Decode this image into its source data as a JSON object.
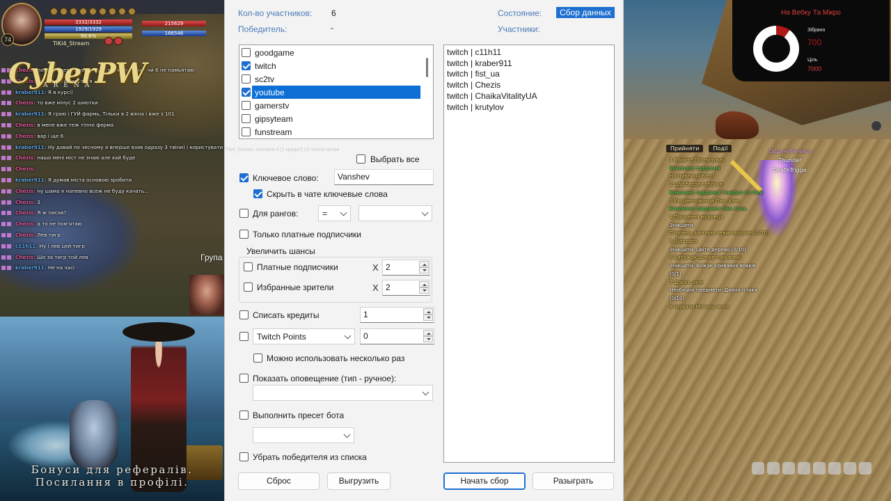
{
  "stream_left": {
    "hud": {
      "level": "74",
      "hp": "3332/3332",
      "mp": "1929/1929",
      "xp": "90.6%",
      "player_name": "TiKi4_Stream",
      "right_hp": "215629",
      "right_mp": "166546"
    },
    "chat": [
      {
        "user": "Chezis:",
        "cls": "c1",
        "text": "поножі і верх плюс мінус терпимо 5 ранг чи 6 не памьятаю"
      },
      {
        "user": "Chezis:",
        "cls": "c1",
        "text": "який порту береться"
      },
      {
        "user": "kraber911:",
        "cls": "c2",
        "text": "Я в курсі)"
      },
      {
        "user": "Chezis:",
        "cls": "c1",
        "text": "то вже мінус 2 шмотки"
      },
      {
        "user": "kraber911:",
        "cls": "c2",
        "text": "Я граю і ГУЙ фармь, Тільки в 2 вікна і вже з 101"
      },
      {
        "user": "Chezis:",
        "cls": "c1",
        "text": "в мене вже теж тіпно ферма"
      },
      {
        "user": "Chezis:",
        "cls": "c1",
        "text": "вар і ще 6"
      },
      {
        "user": "kraber911:",
        "cls": "c2",
        "text": "Ну давай по чесному я вперше взяв одразу 3 твіни) і користувати"
      },
      {
        "user": "Chezis:",
        "cls": "c1",
        "text": "нашо мені міст не знаю але хай буде"
      },
      {
        "user": "Chezis:",
        "cls": "c1",
        "text": ""
      },
      {
        "user": "kraber911:",
        "cls": "c2",
        "text": "Я думав міста основою зробити"
      },
      {
        "user": "Chezis:",
        "cls": "c1",
        "text": "ну шама я напевно всеж не буду качать..."
      },
      {
        "user": "Chezis:",
        "cls": "c1",
        "text": "3"
      },
      {
        "user": "Chezis:",
        "cls": "c1",
        "text": "Я ж писав?"
      },
      {
        "user": "Chezis:",
        "cls": "c1",
        "text": "а то не пом'ятаю"
      },
      {
        "user": "Chezis:",
        "cls": "c1",
        "text": "Лев тигр"
      },
      {
        "user": "c11h11:",
        "cls": "c2",
        "text": "Ну і лев цей тигр"
      },
      {
        "user": "Chezis:",
        "cls": "c1",
        "text": "Шо за тигр той лев"
      },
      {
        "user": "kraber911:",
        "cls": "c2",
        "text": "Не на часі"
      }
    ],
    "group_label": "Група",
    "banner": {
      "logo": "CyberPW",
      "logo_sub": "ARENA",
      "promo_line1": "Бонуси для рефералів.",
      "promo_line2": "Посилання в профілі."
    }
  },
  "app": {
    "participants_count_label": "Кол-во участников:",
    "participants_count_value": "6",
    "winner_label": "Победитель:",
    "winner_value": "-",
    "state_label": "Состояние:",
    "state_value": "Сбор данных",
    "participants_label": "Участники:",
    "platforms": [
      {
        "label": "goodgame",
        "checked": false,
        "selected": false
      },
      {
        "label": "twitch",
        "checked": true,
        "selected": false
      },
      {
        "label": "sc2tv",
        "checked": false,
        "selected": false
      },
      {
        "label": "youtube",
        "checked": true,
        "selected": true
      },
      {
        "label": "gamerstv",
        "checked": false,
        "selected": false
      },
      {
        "label": "gipsyteam",
        "checked": false,
        "selected": false
      },
      {
        "label": "funstream",
        "checked": false,
        "selected": false
      }
    ],
    "select_all_label": "Выбрать все",
    "keyword_label": "Ключевое слово:",
    "keyword_value": "Vanshev",
    "hide_keywords_label": "Скрыть в чате ключевые слова",
    "ranks_label": "Для рангов:",
    "ranks_operator": "=",
    "ranks_value": "",
    "paid_only_label": "Только платные подписчики",
    "boost_group_title": "Увеличить шансы",
    "boost_paid_label": "Платные подписчики",
    "boost_paid_mult": "2",
    "boost_fav_label": "Избранные зрители",
    "boost_fav_mult": "2",
    "x_mark": "X",
    "credits_label": "Списать кредиты",
    "credits_value": "1",
    "points_type": "Twitch Points",
    "points_value": "0",
    "multi_use_label": "Можно использовать несколько раз",
    "show_alert_label": "Показать оповещение (тип - ручное):",
    "alert_type_value": "",
    "bot_preset_label": "Выполнить пресет бота",
    "bot_preset_value": "",
    "remove_winner_label": "Убрать победителя из списка",
    "faint_text": "Tiki4_Stream: поклала 4 (1 кредит) 10 тікетів почав",
    "participants": [
      "twitch | c11h11",
      "twitch | kraber911",
      "twitch | fist_ua",
      "twitch | Chezis",
      "twitch | ChaikaVitalityUA",
      "twitch | krutylov"
    ],
    "buttons": {
      "reset": "Сброс",
      "export": "Выгрузить",
      "start": "Начать сбор",
      "draw": "Разыграть"
    }
  },
  "game_right": {
    "goal": {
      "title": "На Вебку Та Мікро",
      "collected_label": "Зібрано",
      "collected_value": "700",
      "target_label": "Ціль",
      "target_value": "7000"
    },
    "dialog_accept": "Прийняти",
    "dialog_events": "Події",
    "npc_name": "Орден Фенікса",
    "npc_sub": "Thunder",
    "npc_sub2": "DeathTrigge",
    "quests": [
      {
        "cls": "q-title",
        "text": "1 Вбийте Пронизувач"
      },
      {
        "cls": "q-done",
        "text": "Виконано завдання"
      },
      {
        "cls": "q-title",
        "text": "Наставниця Кен І"
      },
      {
        "cls": "q-title",
        "text": "2 Цар бесов-гоблінів"
      },
      {
        "cls": "q-done",
        "text": "Виконано завдання Генерал Са Фей"
      },
      {
        "cls": "q-title",
        "text": "3 Ексцентричний Лінь Хань"
      },
      {
        "cls": "q-done",
        "text": "Виконано завдання Лінь Хань"
      },
      {
        "cls": "q-title",
        "text": "4 Прохання мудреця"
      },
      {
        "cls": "q-item",
        "text": "Знищити:"
      },
      {
        "cls": "q-title",
        "text": "Стрілець злобних левів-оборотн (0/10)"
      },
      {
        "cls": "q-title",
        "text": "5 Відплата"
      },
      {
        "cls": "q-item",
        "text": "Знищити: Цвіте дерево (0/10)"
      },
      {
        "cls": "q-title",
        "text": "6 Ватажок шляхетних вовкі"
      },
      {
        "cls": "q-item",
        "text": "Знищити: Вожак кривавих вовків"
      },
      {
        "cls": "q-item",
        "text": "(0/1)"
      },
      {
        "cls": "q-title",
        "text": "7 Доказ сили"
      },
      {
        "cls": "q-item",
        "text": "Необхідні предмети: Дивна плака"
      },
      {
        "cls": "q-item",
        "text": "(0/10)"
      },
      {
        "cls": "q-title",
        "text": "8 Шукати Могилу меча"
      }
    ]
  }
}
